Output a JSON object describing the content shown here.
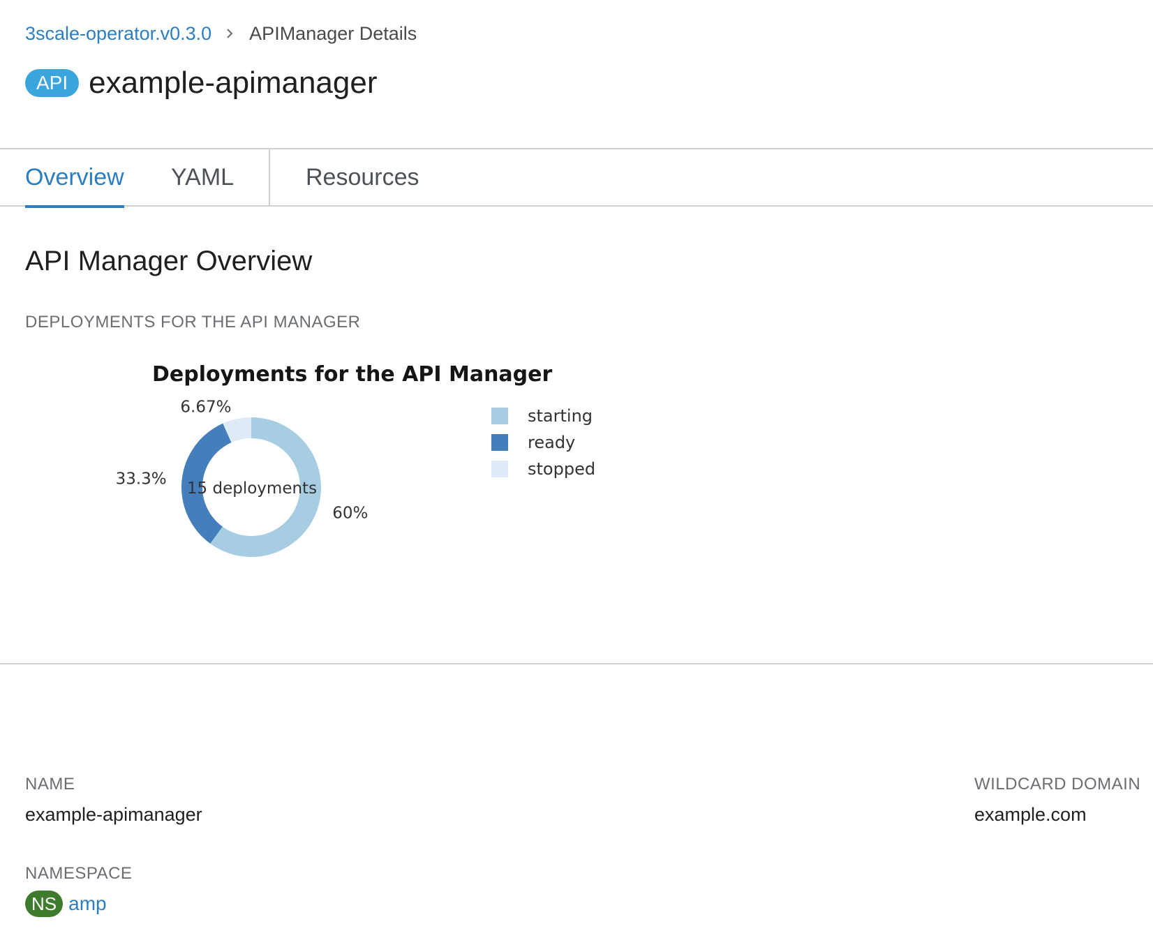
{
  "breadcrumb": {
    "parent": "3scale-operator.v0.3.0",
    "current": "APIManager Details"
  },
  "header": {
    "kind_badge": "API",
    "title": "example-apimanager"
  },
  "tabs": [
    {
      "label": "Overview",
      "active": true
    },
    {
      "label": "YAML",
      "active": false
    },
    {
      "label": "Resources",
      "active": false
    }
  ],
  "overview": {
    "title": "API Manager Overview",
    "deployments_label": "DEPLOYMENTS FOR THE API MANAGER"
  },
  "chart_data": {
    "type": "pie",
    "title": "Deployments for the API Manager",
    "center_label": "15 deployments",
    "categories": [
      "starting",
      "ready",
      "stopped"
    ],
    "values": [
      9,
      5,
      1
    ],
    "percent_labels": [
      "60%",
      "33.3%",
      "6.67%"
    ],
    "colors": [
      "#a6cde1",
      "#447fbb",
      "#deebf6"
    ],
    "legend_position": "right"
  },
  "details": {
    "name_label": "NAME",
    "name_value": "example-apimanager",
    "namespace_label": "NAMESPACE",
    "namespace_badge": "NS",
    "namespace_value": "amp",
    "wildcard_label": "WILDCARD DOMAIN",
    "wildcard_value": "example.com"
  },
  "colors": {
    "link": "#2b7ec1",
    "api_badge": "#39a5dc",
    "ns_badge": "#3f7b2d"
  }
}
